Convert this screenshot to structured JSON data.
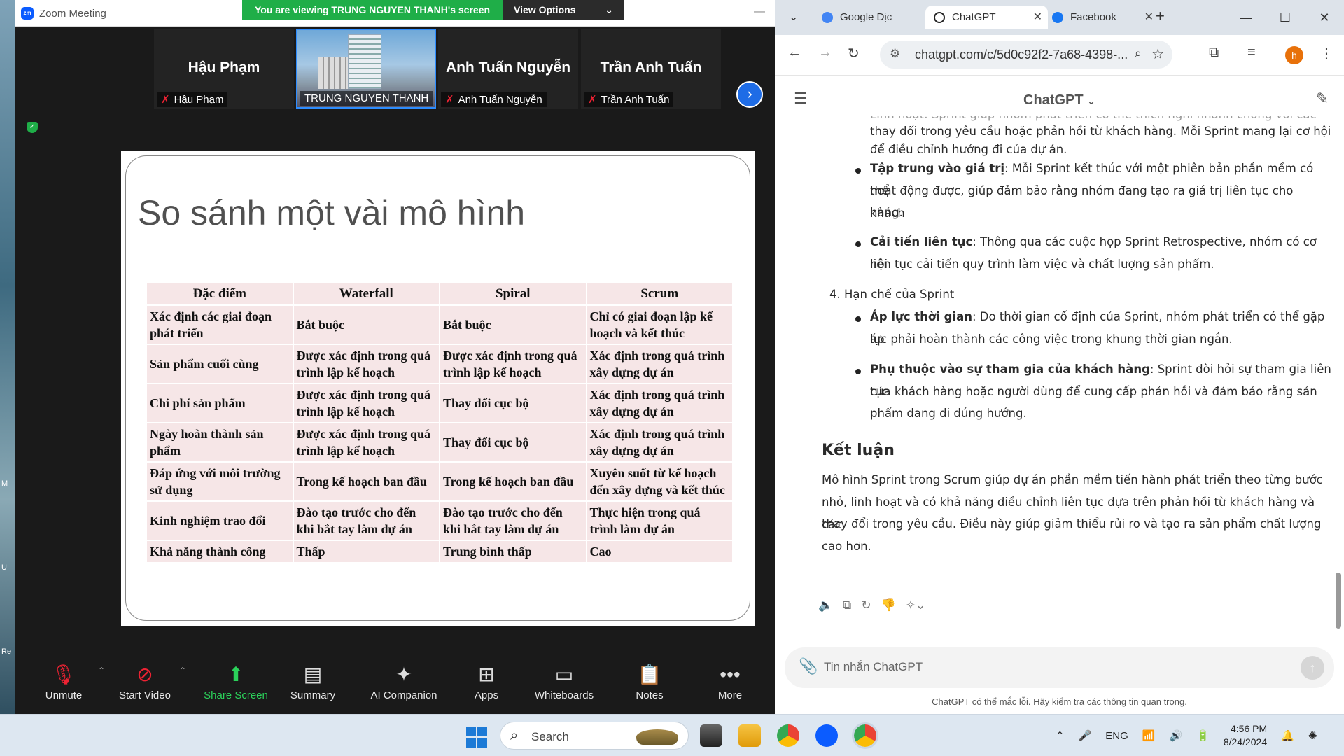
{
  "desktop": {
    "labels": [
      "M",
      "U",
      "Re"
    ]
  },
  "zoom": {
    "title": "Zoom Meeting",
    "viewing_banner": "You are viewing TRUNG NGUYEN THANH's screen",
    "view_options": "View Options",
    "participants": [
      {
        "big": "Hậu Phạm",
        "label": "Hậu Phạm"
      },
      {
        "big": "",
        "label": "TRUNG NGUYEN THANH"
      },
      {
        "big": "Anh Tuấn Nguyễn",
        "label": "Anh Tuấn Nguyễn"
      },
      {
        "big": "Trần Anh Tuấn",
        "label": "Trần Anh Tuấn"
      }
    ],
    "slide": {
      "title": "So sánh một vài mô hình",
      "headers": [
        "Đặc điểm",
        "Waterfall",
        "Spiral",
        "Scrum"
      ],
      "rows": [
        [
          "Xác định các giai đoạn phát triển",
          "Bắt buộc",
          "Bắt buộc",
          "Chỉ có giai đoạn lập kế hoạch và kết thúc"
        ],
        [
          "Sản phẩm cuối cùng",
          "Được xác định trong quá trình lập kế hoạch",
          "Được xác định trong quá trình lập kế hoạch",
          "Xác định trong quá trình xây dựng dự án"
        ],
        [
          "Chi phí sản phẩm",
          "Được xác định trong quá trình lập kế hoạch",
          "Thay đổi cục bộ",
          "Xác định trong quá trình xây dựng dự án"
        ],
        [
          "Ngày hoàn thành sản phẩm",
          "Được xác định trong quá trình lập kế hoạch",
          "Thay đổi cục bộ",
          "Xác định trong quá trình xây dựng dự án"
        ],
        [
          "Đáp ứng với môi trường sử dụng",
          "Trong kế hoạch ban đầu",
          "Trong kế hoạch ban đầu",
          "Xuyên suốt từ kế hoạch đến xây dựng và kết thúc"
        ],
        [
          "Kinh nghiệm trao đổi",
          "Đào tạo trước cho đến khi bắt tay làm dự án",
          "Đào tạo trước cho đến khi bắt tay làm dự án",
          "Thực hiện trong quá trình làm dự án"
        ],
        [
          "Khả năng thành công",
          "Thấp",
          "Trung bình thấp",
          "Cao"
        ]
      ]
    },
    "toolbar": [
      "Unmute",
      "Start Video",
      "Share Screen",
      "Summary",
      "AI Companion",
      "Apps",
      "Whiteboards",
      "Notes",
      "More"
    ]
  },
  "chrome": {
    "tabs": [
      "Google Dịc",
      "ChatGPT",
      "Facebook"
    ],
    "url": "chatgpt.com/c/5d0c92f2-7a68-4398-...",
    "avatar": "h",
    "page_title": "ChatGPT",
    "content": {
      "top_partial_1": "Linh hoạt: Sprint giúp nhóm phát triển có thể thích nghi nhanh chóng với các",
      "top_partial_2": "thay đổi trong yêu cầu hoặc phản hồi từ khách hàng. Mỗi Sprint mang lại cơ hội",
      "top_partial_3": "để điều chỉnh hướng đi của dự án.",
      "b1_title": "Tập trung vào giá trị",
      "b1_l1": ": Mỗi Sprint kết thúc với một phiên bản phần mềm có thể",
      "b1_l2": "hoạt động được, giúp đảm bảo rằng nhóm đang tạo ra giá trị liên tục cho khách",
      "b1_l3": "hàng.",
      "b2_title": "Cải tiến liên tục",
      "b2_l1": ": Thông qua các cuộc họp Sprint Retrospective, nhóm có cơ hội",
      "b2_l2": "liên tục cải tiến quy trình làm việc và chất lượng sản phẩm.",
      "section4": "4.  Hạn chế của Sprint",
      "b3_title": "Áp lực thời gian",
      "b3_l1": ": Do thời gian cố định của Sprint, nhóm phát triển có thể gặp áp",
      "b3_l2": "lực phải hoàn thành các công việc trong khung thời gian ngắn.",
      "b4_title": "Phụ thuộc vào sự tham gia của khách hàng",
      "b4_l1": ": Sprint đòi hỏi sự tham gia liên tục",
      "b4_l2": "của khách hàng hoặc người dùng để cung cấp phản hồi và đảm bảo rằng sản",
      "b4_l3": "phẩm đang đi đúng hướng.",
      "conclusion_heading": "Kết luận",
      "c_l1": "Mô hình Sprint trong Scrum giúp dự án phần mềm tiến hành phát triển theo từng bước",
      "c_l2": "nhỏ, linh hoạt và có khả năng điều chỉnh liên tục dựa trên phản hồi từ khách hàng và các",
      "c_l3": "thay đổi trong yêu cầu. Điều này giúp giảm thiểu rủi ro và tạo ra sản phẩm chất lượng",
      "c_l4": "cao hơn."
    },
    "composer_placeholder": "Tin nhắn ChatGPT",
    "disclaimer": "ChatGPT có thể mắc lỗi. Hãy kiểm tra các thông tin quan trọng."
  },
  "taskbar": {
    "search": "Search",
    "lang": "ENG",
    "time": "4:56 PM",
    "date": "8/24/2024"
  },
  "colors": {
    "zoom_green": "#1fae48",
    "zoom_blue": "#1e6ce6",
    "slide_cell": "#f6e6e7"
  }
}
